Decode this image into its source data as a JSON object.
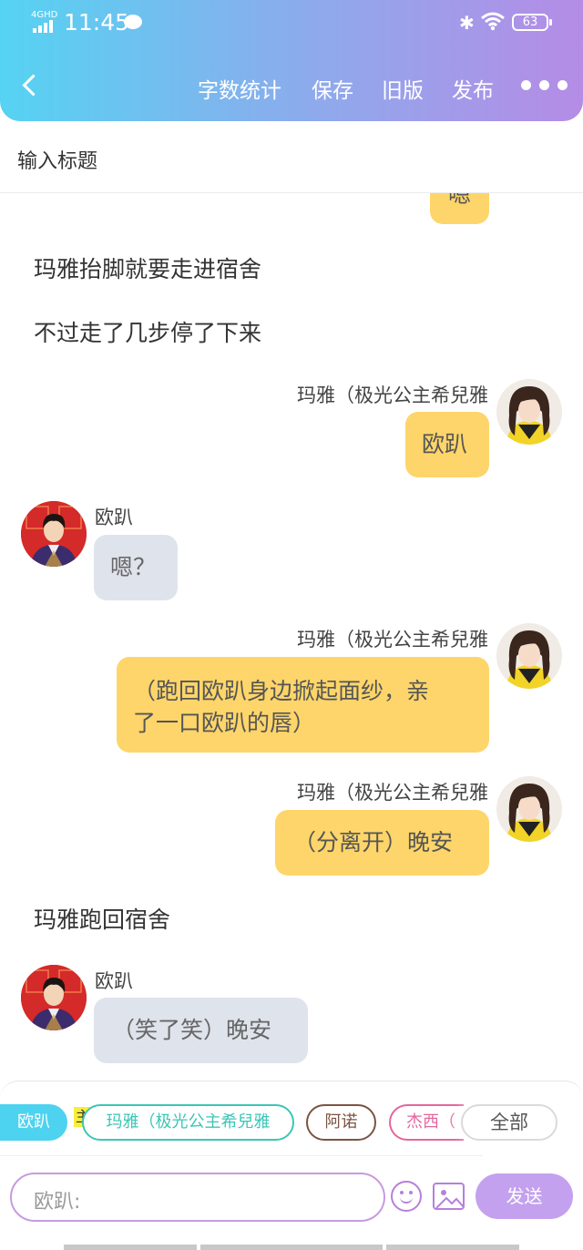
{
  "status_bar": {
    "time": "11:45",
    "network": "4GHD",
    "battery": "63"
  },
  "header": {
    "actions": [
      "字数统计",
      "保存",
      "旧版",
      "发布"
    ]
  },
  "title_placeholder": "输入标题",
  "partial_bubble_text": "嗯",
  "narration": {
    "line1": "玛雅抬脚就要走进宿舍",
    "line2": "不过走了几步停了下来",
    "line3": "玛雅跑回宿舍"
  },
  "messages": [
    {
      "speaker": "玛雅（极光公主希兒雅",
      "text": "欧趴"
    },
    {
      "speaker": "欧趴",
      "text": "嗯？"
    },
    {
      "speaker": "玛雅（极光公主希兒雅",
      "text_line1": "（跑回欧趴身边掀起面纱，亲",
      "text_line2": "了一口欧趴的唇）"
    },
    {
      "speaker": "玛雅（极光公主希兒雅",
      "text": "（分离开）晚安"
    },
    {
      "speaker": "欧趴",
      "text": "（笑了笑）晚安"
    }
  ],
  "role_bar": {
    "chips": [
      "欧趴",
      "玛雅（极光公主希兒雅",
      "阿诺",
      "杰西（",
      "全部"
    ],
    "owner_tag": "主"
  },
  "composer": {
    "input_placeholder": "欧趴:",
    "send_label": "发送"
  },
  "colors": {
    "header_gradient_start": "#55d3f2",
    "header_gradient_end": "#b58ce6",
    "bubble_yellow": "#fdd56a",
    "bubble_gray": "#dfe3ec",
    "send_button": "#c4a1ee",
    "chip_active": "#4dd2f0",
    "chip_teal": "#3cc6b5",
    "chip_brown": "#7b5443",
    "chip_pink": "#e3679e"
  }
}
